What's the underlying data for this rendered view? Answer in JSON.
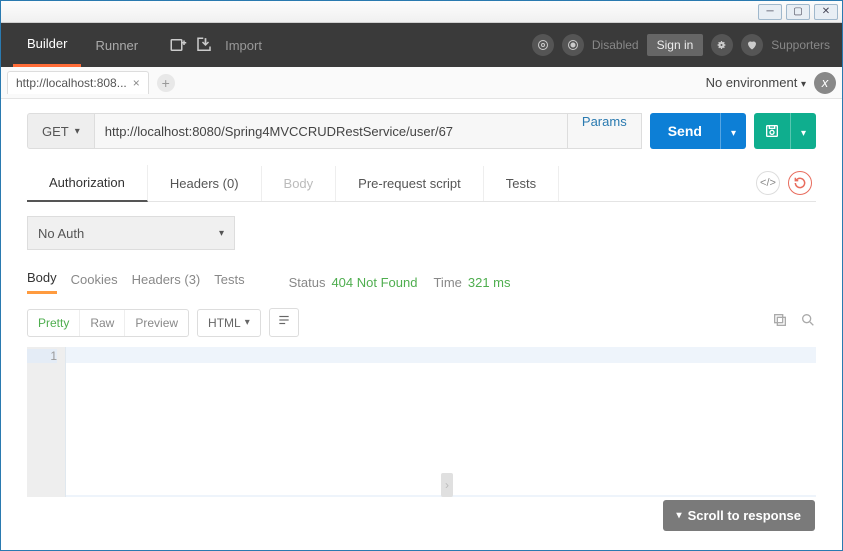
{
  "header": {
    "tabs": [
      "Builder",
      "Runner"
    ],
    "active_tab": 0,
    "import_label": "Import",
    "disabled_label": "Disabled",
    "signin_label": "Sign in",
    "supporters_label": "Supporters"
  },
  "tabbar": {
    "tab_label": "http://localhost:808...",
    "env_label": "No environment"
  },
  "request": {
    "method": "GET",
    "url": "http://localhost:8080/Spring4MVCCRUDRestService/user/67",
    "params_label": "Params",
    "send_label": "Send",
    "tabs": {
      "authorization": "Authorization",
      "headers": "Headers (0)",
      "body": "Body",
      "prerequest": "Pre-request script",
      "tests": "Tests"
    },
    "auth_value": "No Auth"
  },
  "response": {
    "tabs": {
      "body": "Body",
      "cookies": "Cookies",
      "headers": "Headers (3)",
      "tests": "Tests"
    },
    "status_label": "Status",
    "status_value": "404 Not Found",
    "time_label": "Time",
    "time_value": "321 ms",
    "view": {
      "pretty": "Pretty",
      "raw": "Raw",
      "preview": "Preview",
      "format": "HTML"
    },
    "line_no": "1"
  },
  "footer": {
    "scroll_label": "Scroll to response"
  }
}
